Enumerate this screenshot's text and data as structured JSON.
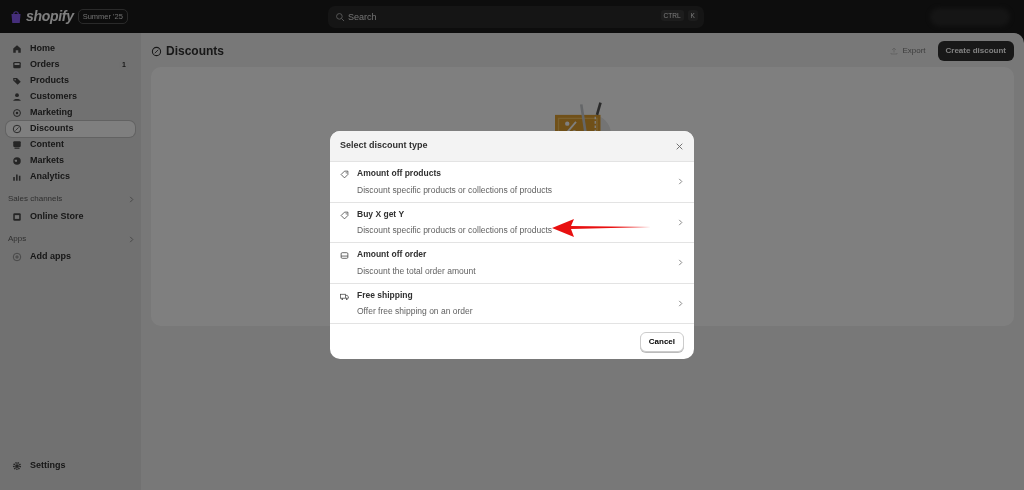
{
  "topbar": {
    "brand": "shopify",
    "edition_badge": "Summer '25",
    "search": {
      "placeholder": "Search",
      "shortcut_keys": [
        "CTRL",
        "K"
      ]
    }
  },
  "sidebar": {
    "items": [
      {
        "label": "Home",
        "selected": false
      },
      {
        "label": "Orders",
        "badge": "1",
        "selected": false
      },
      {
        "label": "Products",
        "selected": false
      },
      {
        "label": "Customers",
        "selected": false
      },
      {
        "label": "Marketing",
        "selected": false
      },
      {
        "label": "Discounts",
        "selected": true
      },
      {
        "label": "Content",
        "selected": false
      },
      {
        "label": "Markets",
        "selected": false
      },
      {
        "label": "Analytics",
        "selected": false
      }
    ],
    "sections": [
      {
        "title": "Sales channels",
        "items": [
          {
            "label": "Online Store",
            "selected": false
          }
        ]
      },
      {
        "title": "Apps",
        "items": [
          {
            "label": "Add apps",
            "selected": false
          }
        ]
      }
    ],
    "footer_item": {
      "label": "Settings"
    }
  },
  "page": {
    "title": "Discounts",
    "actions": [
      {
        "label": "Export",
        "kind": "secondary",
        "disabled": true
      },
      {
        "label": "Create discount",
        "kind": "primary",
        "disabled": false
      }
    ]
  },
  "modal": {
    "title": "Select discount type",
    "options": [
      {
        "title": "Amount off products",
        "description": "Discount specific products or collections of products"
      },
      {
        "title": "Buy X get Y",
        "description": "Discount specific products or collections of products"
      },
      {
        "title": "Amount off order",
        "description": "Discount the total order amount"
      },
      {
        "title": "Free shipping",
        "description": "Offer free shipping on an order"
      }
    ],
    "buttons": [
      "Cancel"
    ]
  }
}
